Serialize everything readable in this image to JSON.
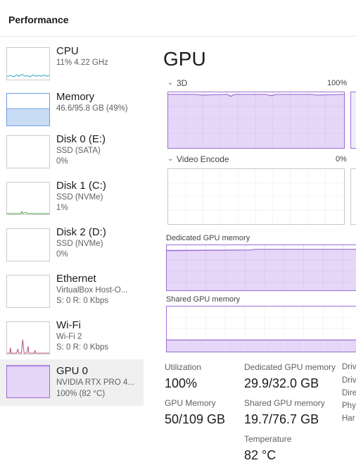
{
  "header": {
    "title": "Performance"
  },
  "sidebar": {
    "items": [
      {
        "name": "CPU",
        "sub": "11%  4.22 GHz",
        "sub2": ""
      },
      {
        "name": "Memory",
        "sub": "46.6/95.8 GB (49%)",
        "sub2": ""
      },
      {
        "name": "Disk 0 (E:)",
        "sub": "SSD (SATA)",
        "sub2": "0%"
      },
      {
        "name": "Disk 1 (C:)",
        "sub": "SSD (NVMe)",
        "sub2": "1%"
      },
      {
        "name": "Disk 2 (D:)",
        "sub": "SSD (NVMe)",
        "sub2": "0%"
      },
      {
        "name": "Ethernet",
        "sub": "VirtualBox Host-O...",
        "sub2": "S: 0  R: 0 Kbps"
      },
      {
        "name": "Wi-Fi",
        "sub": "Wi-Fi 2",
        "sub2": "S: 0  R: 0 Kbps"
      },
      {
        "name": "GPU 0",
        "sub": "NVIDIA RTX PRO 4...",
        "sub2": "100%  (82 °C)"
      }
    ]
  },
  "main": {
    "title": "GPU",
    "engines": [
      {
        "label": "3D",
        "pct": "100%"
      },
      {
        "label": "Video Encode",
        "pct": "0%"
      }
    ],
    "dedicated_label": "Dedicated GPU memory",
    "shared_label": "Shared GPU memory",
    "stats": {
      "utilization_label": "Utilization",
      "utilization_value": "100%",
      "gpu_memory_label": "GPU Memory",
      "gpu_memory_value": "50/109 GB",
      "dedicated_label": "Dedicated GPU memory",
      "dedicated_value": "29.9/32.0 GB",
      "shared_label": "Shared GPU memory",
      "shared_value": "19.7/76.7 GB",
      "temperature_label": "Temperature",
      "temperature_value": "82 °C"
    },
    "clipped_labels": [
      "Driv",
      "Driv",
      "Dire",
      "Phy",
      "Har"
    ]
  },
  "colors": {
    "gpu_purple": "#9b6bd6",
    "gpu_fill": "#e6d6f7",
    "memory_blue": "#6b9ee0",
    "memory_fill": "#c9dcf5",
    "cpu_line": "#2a9ec5",
    "wifi_line": "#b5467a",
    "disk_line": "#3d9a3d"
  }
}
